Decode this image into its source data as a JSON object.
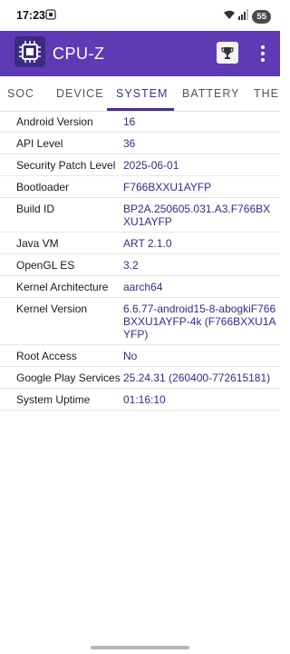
{
  "status_bar": {
    "time": "17:23",
    "battery": "55",
    "icons": [
      "screenshot-icon",
      "wifi-icon",
      "signal-icon"
    ]
  },
  "app_bar": {
    "title": "CPU-Z",
    "background": "#5e3bb5",
    "icons": [
      "cpu-logo-icon",
      "trophy-icon",
      "more-vert-icon"
    ]
  },
  "tabs": [
    "SOC",
    "DEVICE",
    "SYSTEM",
    "BATTERY",
    "THER"
  ],
  "active_tab": "SYSTEM",
  "accent": "#4a2aa0",
  "system_info": [
    {
      "label": "Android Version",
      "value": "16"
    },
    {
      "label": "API Level",
      "value": "36"
    },
    {
      "label": "Security Patch Level",
      "value": "2025-06-01"
    },
    {
      "label": "Bootloader",
      "value": "F766BXXU1AYFP"
    },
    {
      "label": "Build ID",
      "value": "BP2A.250605.031.A3.F766BXXU1AYFP"
    },
    {
      "label": "Java VM",
      "value": "ART 2.1.0"
    },
    {
      "label": "OpenGL ES",
      "value": "3.2"
    },
    {
      "label": "Kernel Architecture",
      "value": "aarch64"
    },
    {
      "label": "Kernel Version",
      "value": "6.6.77-android15-8-abogkiF766BXXU1AYFP-4k (F766BXXU1AYFP)"
    },
    {
      "label": "Root Access",
      "value": "No"
    },
    {
      "label": "Google Play Services",
      "value": "25.24.31 (260400-772615181)"
    },
    {
      "label": "System Uptime",
      "value": "01:16:10"
    }
  ]
}
